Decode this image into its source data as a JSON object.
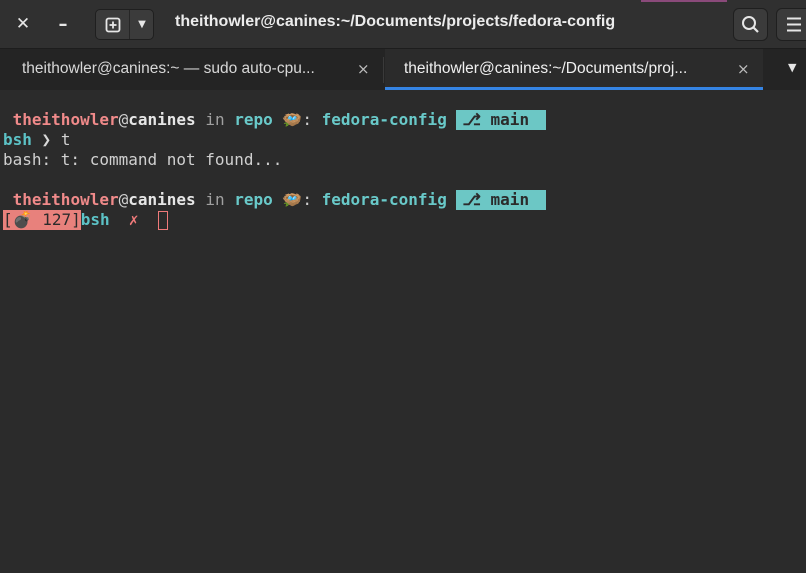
{
  "window": {
    "title": "theithowler@canines:~/Documents/projects/fedora-config"
  },
  "tabs": [
    {
      "label": "theithowler@canines:~ — sudo auto-cpu...",
      "close": "×",
      "active": false
    },
    {
      "label": "theithowler@canines:~/Documents/proj...",
      "close": "×",
      "active": true
    }
  ],
  "prompt": {
    "user": "theithowler",
    "at": "@",
    "host": "canines",
    "in": " in ",
    "repo": "repo",
    "repo_icon": "🪺",
    "colon": ":",
    "dir": "fedora-config",
    "branch": "⎇ main",
    "shell": "bsh",
    "chevron": "❯"
  },
  "session": {
    "command1": "t",
    "output1": "bash: t: command not found...",
    "error_badge": "[💣 127]",
    "error_mark": "✗"
  },
  "colors": {
    "accent": "#3584e4",
    "user": "#f08a8a",
    "cyan": "#69c9c9",
    "branch_bg": "#6cc7c5",
    "error_bg": "#e8817c"
  }
}
